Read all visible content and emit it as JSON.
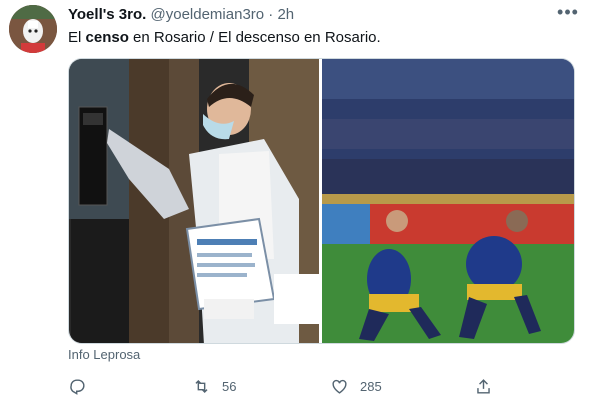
{
  "tweet": {
    "display_name": "Yoell's 3ro.",
    "handle": "@yoeldemian3ro",
    "separator": "·",
    "time": "2h",
    "more_label": "•••",
    "text_before": "El ",
    "text_bold": "censo",
    "text_after": " en Rosario / El descenso en Rosario.",
    "media_source": "Info Leprosa",
    "actions": {
      "reply_count": "",
      "retweet_count": "56",
      "like_count": "285"
    }
  },
  "colors": {
    "text_primary": "#0f1419",
    "text_secondary": "#536471",
    "border": "#cfd9de"
  },
  "icons": [
    "avatar",
    "more-icon",
    "reply-icon",
    "retweet-icon",
    "like-icon",
    "share-icon"
  ]
}
